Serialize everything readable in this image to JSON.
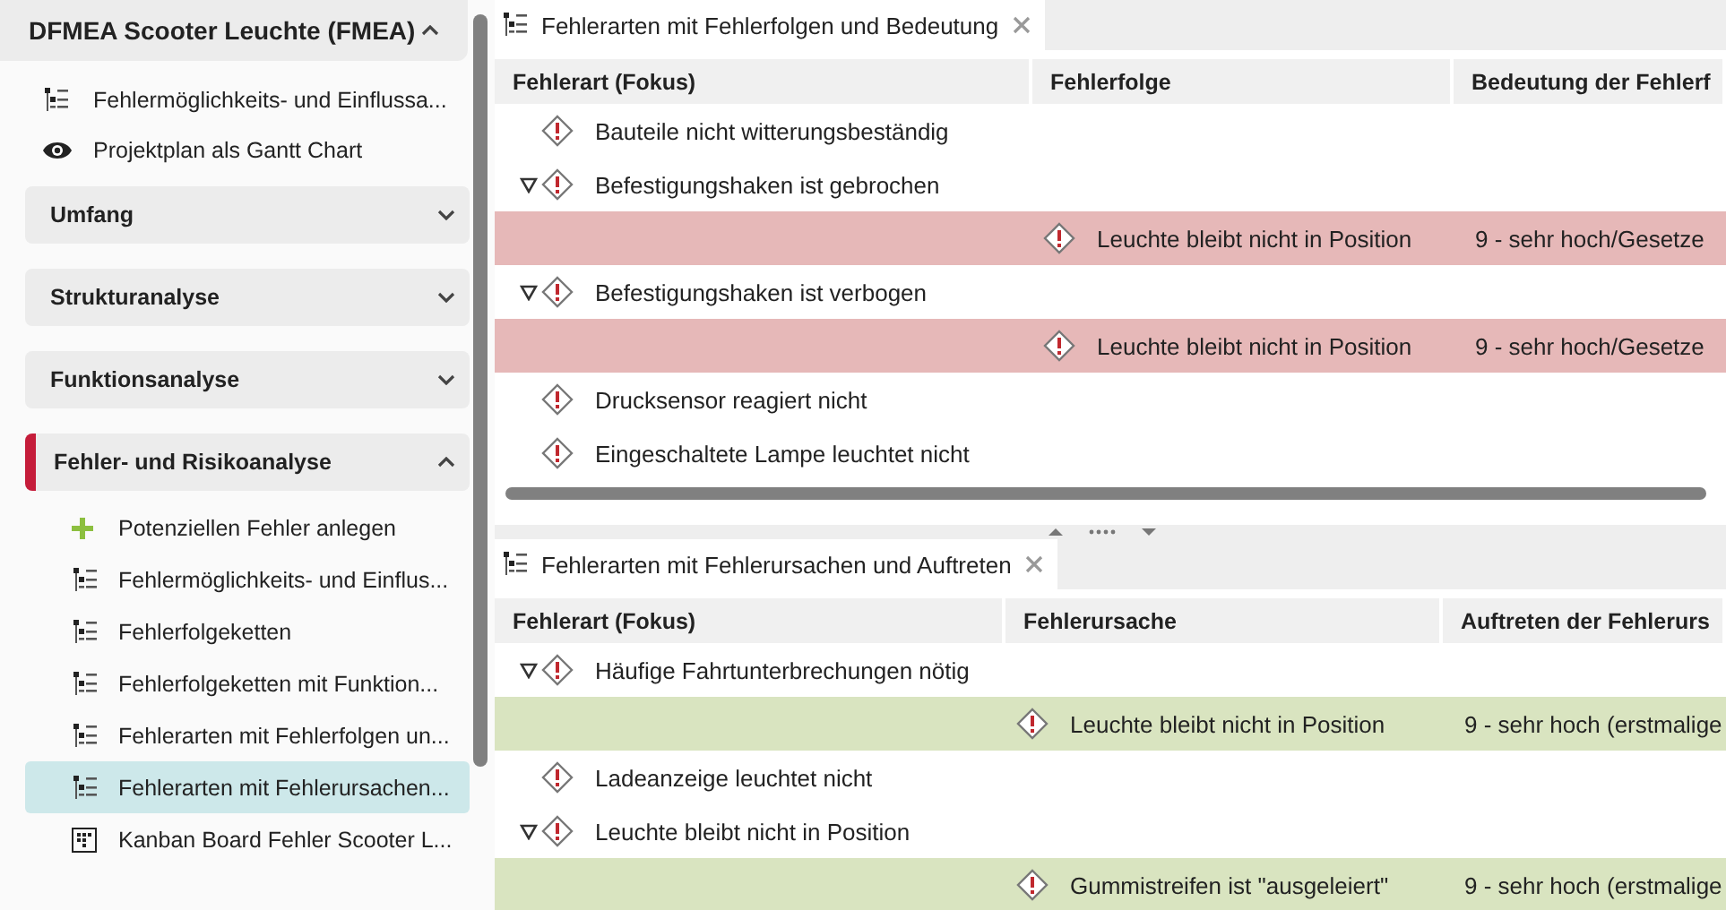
{
  "sidebar": {
    "title": "DFMEA Scooter Leuchte (FMEA)",
    "expanded": true,
    "items": [
      {
        "kind": "list",
        "label": "Fehlermöglichkeits- und Einflussa...",
        "selected": false
      },
      {
        "kind": "eye",
        "label": "Projektplan als Gantt Chart",
        "selected": false
      }
    ],
    "sections": [
      {
        "label": "Umfang",
        "expanded": false,
        "active": false
      },
      {
        "label": "Strukturanalyse",
        "expanded": false,
        "active": false
      },
      {
        "label": "Funktionsanalyse",
        "expanded": false,
        "active": false
      },
      {
        "label": "Fehler- und Risikoanalyse",
        "expanded": true,
        "active": true,
        "items": [
          {
            "kind": "plus",
            "label": "Potenziellen Fehler anlegen",
            "selected": false
          },
          {
            "kind": "list",
            "label": "Fehlermöglichkeits- und Einflus...",
            "selected": false
          },
          {
            "kind": "list",
            "label": "Fehlerfolgeketten",
            "selected": false
          },
          {
            "kind": "list",
            "label": "Fehlerfolgeketten mit Funktion...",
            "selected": false
          },
          {
            "kind": "list",
            "label": "Fehlerarten mit Fehlerfolgen un...",
            "selected": false
          },
          {
            "kind": "list",
            "label": "Fehlerarten mit Fehlerursachen...",
            "selected": true
          },
          {
            "kind": "board",
            "label": "Kanban Board Fehler Scooter L...",
            "selected": false
          }
        ]
      }
    ]
  },
  "panels": [
    {
      "tab": "Fehlerarten mit Fehlerfolgen und Bedeutung",
      "columns": [
        "Fehlerart (Fokus)",
        "Fehlerfolge",
        "Bedeutung der Fehlerf"
      ],
      "rows": [
        {
          "label": "Bauteile nicht witterungsbeständig"
        },
        {
          "label": "Befestigungshaken ist gebrochen",
          "expanded": true,
          "children": [
            {
              "kind": "effect",
              "text": "Leuchte bleibt nicht in Position",
              "value": "9 - sehr hoch/Gesetze"
            }
          ]
        },
        {
          "label": "Befestigungshaken ist verbogen",
          "expanded": true,
          "children": [
            {
              "kind": "effect",
              "text": "Leuchte bleibt nicht in Position",
              "value": "9 - sehr hoch/Gesetze"
            }
          ]
        },
        {
          "label": "Drucksensor reagiert nicht"
        },
        {
          "label": "Eingeschaltete Lampe leuchtet nicht"
        }
      ]
    },
    {
      "tab": "Fehlerarten mit Fehlerursachen und Auftreten",
      "columns": [
        "Fehlerart (Fokus)",
        "Fehlerursache",
        "Auftreten der Fehlerurs"
      ],
      "rows": [
        {
          "label": "Häufige Fahrtunterbrechungen nötig",
          "expanded": true,
          "children": [
            {
              "kind": "cause",
              "text": "Leuchte bleibt nicht in Position",
              "value": "9 - sehr hoch (erstmalige"
            }
          ]
        },
        {
          "label": "Ladeanzeige leuchtet nicht"
        },
        {
          "label": "Leuchte bleibt nicht in Position",
          "expanded": true,
          "children": [
            {
              "kind": "cause",
              "text": "Gummistreifen ist \"ausgeleiert\"",
              "value": "9 - sehr hoch (erstmalige"
            }
          ]
        }
      ]
    }
  ]
}
